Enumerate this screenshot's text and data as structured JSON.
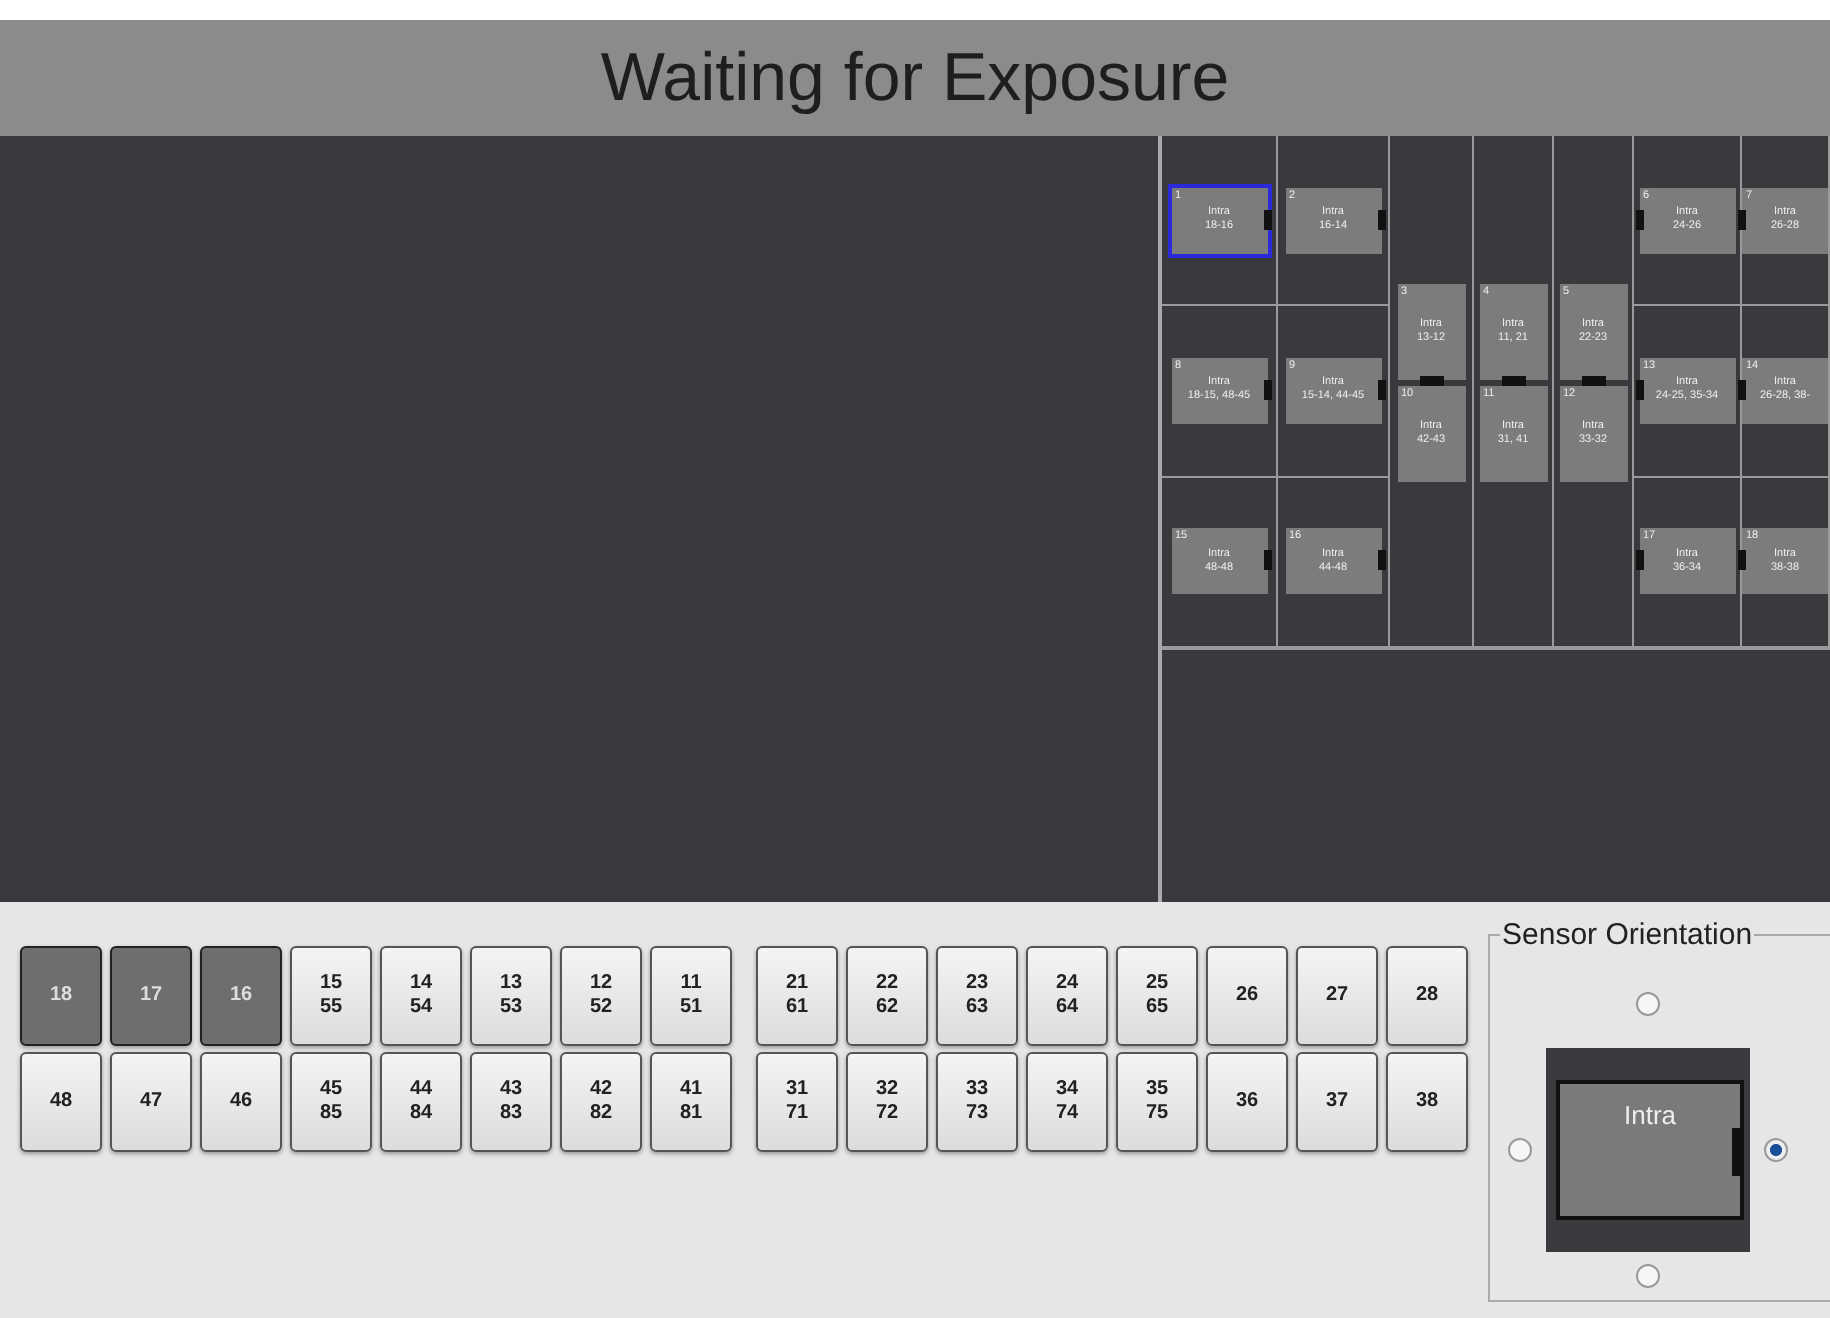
{
  "title": "Waiting for Exposure",
  "layout_columns": [
    {
      "kind": "cells",
      "tiles": [
        {
          "number": "1",
          "label": "Intra",
          "teeth": "18-16",
          "selected": true,
          "kind": "right"
        },
        {
          "number": "8",
          "label": "Intra",
          "teeth": "18-15, 48-45",
          "selected": false,
          "kind": "right"
        },
        {
          "number": "15",
          "label": "Intra",
          "teeth": "48-48",
          "selected": false,
          "kind": "right"
        }
      ]
    },
    {
      "kind": "cells",
      "tiles": [
        {
          "number": "2",
          "label": "Intra",
          "teeth": "16-14",
          "selected": false,
          "kind": "right"
        },
        {
          "number": "9",
          "label": "Intra",
          "teeth": "15-14, 44-45",
          "selected": false,
          "kind": "right"
        },
        {
          "number": "16",
          "label": "Intra",
          "teeth": "44-48",
          "selected": false,
          "kind": "right"
        }
      ]
    },
    {
      "kind": "stack",
      "tiles": [
        {
          "number": "3",
          "label": "Intra",
          "teeth": "13-12",
          "selected": false,
          "kind": "bottom"
        },
        {
          "number": "10",
          "label": "Intra",
          "teeth": "42-43",
          "selected": false,
          "kind": "plain"
        }
      ]
    },
    {
      "kind": "stack",
      "tiles": [
        {
          "number": "4",
          "label": "Intra",
          "teeth": "11, 21",
          "selected": false,
          "kind": "bottom"
        },
        {
          "number": "11",
          "label": "Intra",
          "teeth": "31, 41",
          "selected": false,
          "kind": "plain"
        }
      ]
    },
    {
      "kind": "stack",
      "tiles": [
        {
          "number": "5",
          "label": "Intra",
          "teeth": "22-23",
          "selected": false,
          "kind": "bottom"
        },
        {
          "number": "12",
          "label": "Intra",
          "teeth": "33-32",
          "selected": false,
          "kind": "plain"
        }
      ]
    },
    {
      "kind": "cells",
      "tiles": [
        {
          "number": "6",
          "label": "Intra",
          "teeth": "24-26",
          "selected": false,
          "kind": "left"
        },
        {
          "number": "13",
          "label": "Intra",
          "teeth": "24-25, 35-34",
          "selected": false,
          "kind": "left"
        },
        {
          "number": "17",
          "label": "Intra",
          "teeth": "36-34",
          "selected": false,
          "kind": "left"
        }
      ]
    },
    {
      "kind": "cells",
      "tiles": [
        {
          "number": "7",
          "label": "Intra",
          "teeth": "26-28",
          "selected": false,
          "kind": "left"
        },
        {
          "number": "14",
          "label": "Intra",
          "teeth": "26-28, 38-",
          "selected": false,
          "kind": "left"
        },
        {
          "number": "18",
          "label": "Intra",
          "teeth": "38-38",
          "selected": false,
          "kind": "left"
        }
      ]
    }
  ],
  "tooth_rows": [
    [
      {
        "lines": [
          "18"
        ],
        "selected": true
      },
      {
        "lines": [
          "17"
        ],
        "selected": true
      },
      {
        "lines": [
          "16"
        ],
        "selected": true
      },
      {
        "lines": [
          "15",
          "55"
        ],
        "selected": false
      },
      {
        "lines": [
          "14",
          "54"
        ],
        "selected": false
      },
      {
        "lines": [
          "13",
          "53"
        ],
        "selected": false
      },
      {
        "lines": [
          "12",
          "52"
        ],
        "selected": false
      },
      {
        "lines": [
          "11",
          "51"
        ],
        "selected": false
      },
      {
        "lines": [
          "21",
          "61"
        ],
        "selected": false
      },
      {
        "lines": [
          "22",
          "62"
        ],
        "selected": false
      },
      {
        "lines": [
          "23",
          "63"
        ],
        "selected": false
      },
      {
        "lines": [
          "24",
          "64"
        ],
        "selected": false
      },
      {
        "lines": [
          "25",
          "65"
        ],
        "selected": false
      },
      {
        "lines": [
          "26"
        ],
        "selected": false
      },
      {
        "lines": [
          "27"
        ],
        "selected": false
      },
      {
        "lines": [
          "28"
        ],
        "selected": false
      }
    ],
    [
      {
        "lines": [
          "48"
        ],
        "selected": false
      },
      {
        "lines": [
          "47"
        ],
        "selected": false
      },
      {
        "lines": [
          "46"
        ],
        "selected": false
      },
      {
        "lines": [
          "45",
          "85"
        ],
        "selected": false
      },
      {
        "lines": [
          "44",
          "84"
        ],
        "selected": false
      },
      {
        "lines": [
          "43",
          "83"
        ],
        "selected": false
      },
      {
        "lines": [
          "42",
          "82"
        ],
        "selected": false
      },
      {
        "lines": [
          "41",
          "81"
        ],
        "selected": false
      },
      {
        "lines": [
          "31",
          "71"
        ],
        "selected": false
      },
      {
        "lines": [
          "32",
          "72"
        ],
        "selected": false
      },
      {
        "lines": [
          "33",
          "73"
        ],
        "selected": false
      },
      {
        "lines": [
          "34",
          "74"
        ],
        "selected": false
      },
      {
        "lines": [
          "35",
          "75"
        ],
        "selected": false
      },
      {
        "lines": [
          "36"
        ],
        "selected": false
      },
      {
        "lines": [
          "37"
        ],
        "selected": false
      },
      {
        "lines": [
          "38"
        ],
        "selected": false
      }
    ]
  ],
  "sensor_orientation": {
    "title": "Sensor Orientation",
    "sensor_label": "Intra",
    "options": [
      {
        "kind": "top",
        "selected": false
      },
      {
        "kind": "left",
        "selected": false
      },
      {
        "kind": "right",
        "selected": true
      },
      {
        "kind": "bottom",
        "selected": false
      }
    ]
  }
}
